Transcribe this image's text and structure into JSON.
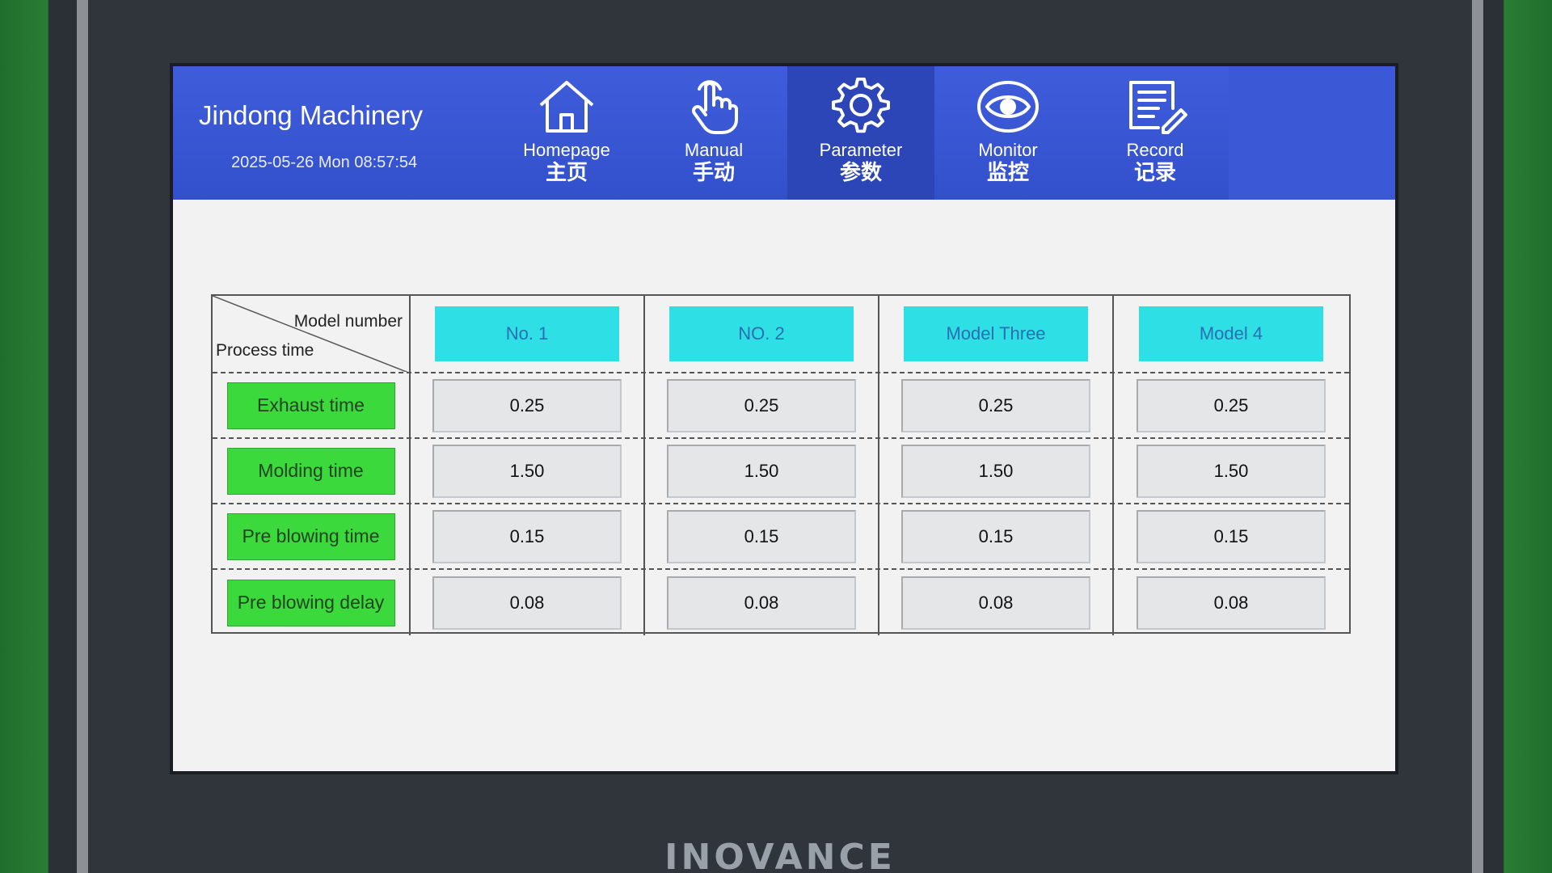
{
  "device": {
    "brand": "INOVANCE"
  },
  "header": {
    "company": "Jindong Machinery",
    "datetime": "2025-05-26 Mon 08:57:54"
  },
  "nav": {
    "items": [
      {
        "en": "Homepage",
        "zh": "主页",
        "icon": "home-icon"
      },
      {
        "en": "Manual",
        "zh": "手动",
        "icon": "hand-pointer-icon"
      },
      {
        "en": "Parameter",
        "zh": "参数",
        "icon": "gear-icon",
        "active": true
      },
      {
        "en": "Monitor",
        "zh": "监控",
        "icon": "eye-icon"
      },
      {
        "en": "Record",
        "zh": "记录",
        "icon": "document-edit-icon"
      }
    ]
  },
  "table": {
    "corner_top": "Model number",
    "corner_bottom": "Process time",
    "models": [
      "No. 1",
      "NO. 2",
      "Model Three",
      "Model 4"
    ],
    "rows": [
      {
        "label": "Exhaust time",
        "values": [
          "0.25",
          "0.25",
          "0.25",
          "0.25"
        ]
      },
      {
        "label": "Molding time",
        "values": [
          "1.50",
          "1.50",
          "1.50",
          "1.50"
        ]
      },
      {
        "label": "Pre blowing time",
        "values": [
          "0.15",
          "0.15",
          "0.15",
          "0.15"
        ]
      },
      {
        "label": "Pre blowing delay",
        "values": [
          "0.08",
          "0.08",
          "0.08",
          "0.08"
        ]
      }
    ]
  },
  "colors": {
    "header_bg": "#3f5ddb",
    "model_button": "#2ee0e6",
    "row_label_button": "#3bd93b"
  }
}
